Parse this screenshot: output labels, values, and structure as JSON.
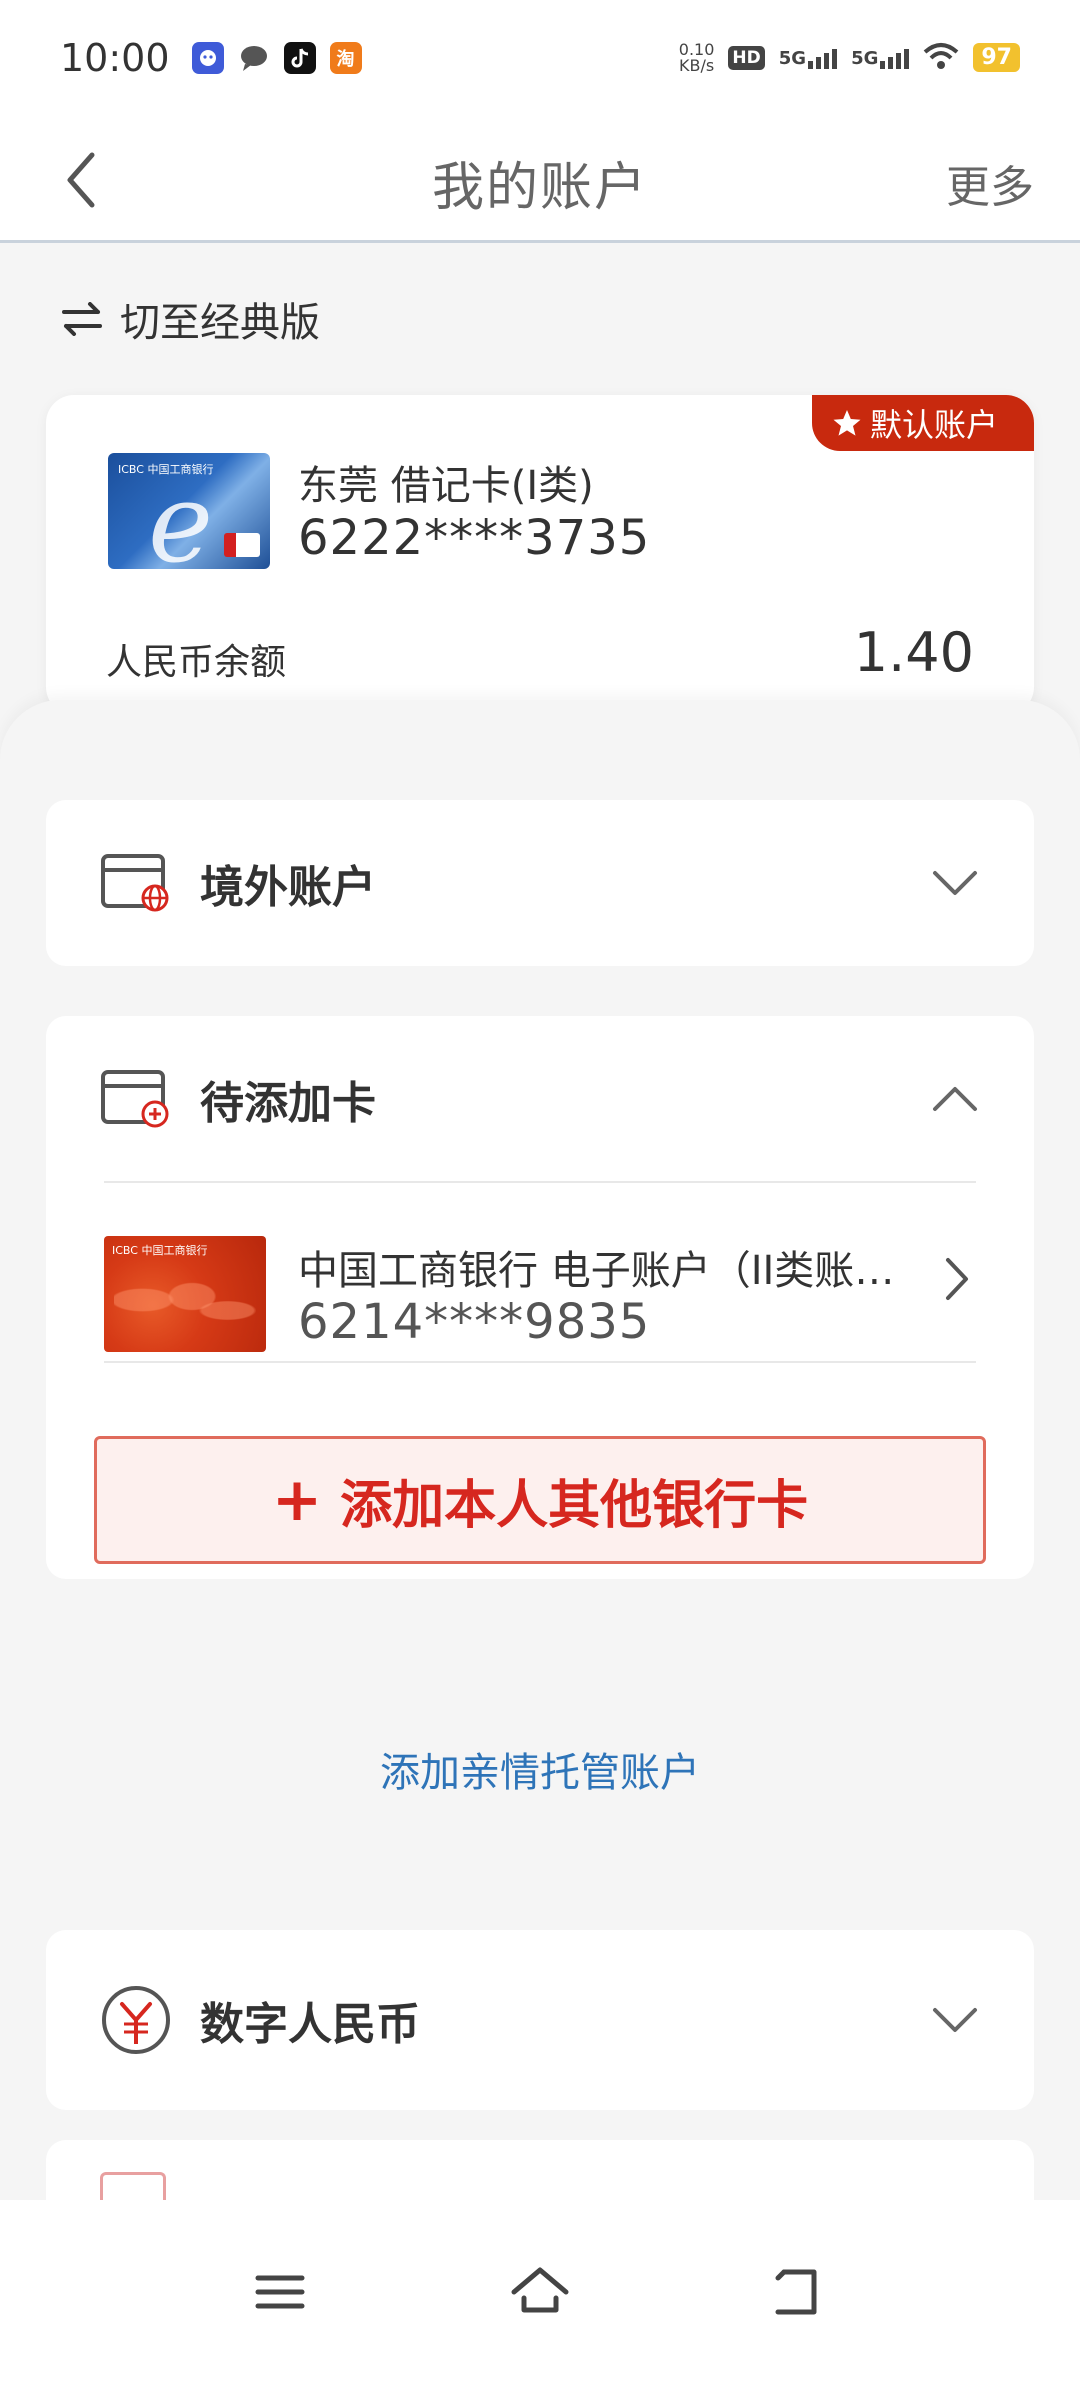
{
  "status_bar": {
    "time": "10:00",
    "net_speed_value": "0.10",
    "net_speed_unit": "KB/s",
    "hd_label": "HD",
    "signal1": "5G",
    "signal2": "5G",
    "battery": "97",
    "apps": [
      "chat-app-icon",
      "message-icon",
      "tiktok-icon",
      "taobao-icon"
    ],
    "taobao_glyph": "淘"
  },
  "header": {
    "title": "我的账户",
    "more": "更多"
  },
  "switch": {
    "label": "切至经典版"
  },
  "default_account": {
    "badge": "默认账户",
    "card_name": "东莞 借记卡(Ⅰ类)",
    "card_number": "6222****3735",
    "balance_label": "人民币余额",
    "balance_value": "1.40",
    "card_brand": "ICBC 中国工商银行"
  },
  "overseas": {
    "title": "境外账户"
  },
  "pending": {
    "title": "待添加卡",
    "card_name": "中国工商银行 电子账户（II类账户）",
    "card_number": "6214****9835",
    "card_brand": "ICBC 中国工商银行",
    "add_button": "添加本人其他银行卡",
    "plus": "+",
    "family_link": "添加亲情托管账户"
  },
  "digital_rmb": {
    "title": "数字人民币"
  },
  "colors": {
    "brand_red": "#d6271f",
    "badge_red": "#c8290e",
    "link_blue": "#2e74b8"
  }
}
